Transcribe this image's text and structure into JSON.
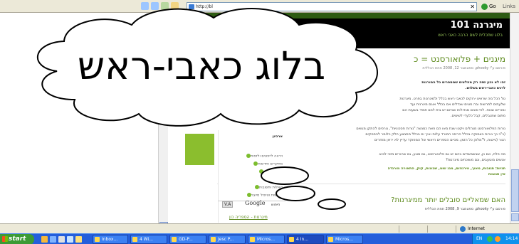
{
  "browser": {
    "address_url": "http://bl",
    "go_label": "Go",
    "links_label": "Links"
  },
  "site": {
    "title": "מיגרנה 101",
    "subtitle": "בלוג שתכלית לשם הרבה כאבי ראש"
  },
  "post1": {
    "title": "מיגנים + פלואורסנט = כ",
    "meta": "פורסם ע\"י phooky, ספטמבר 12, 2008 תחת הכללית",
    "lead": "זהו לא נכון שזה רק מהלצים שמספרים כל המורנות",
    "lead2": "לרגש כאבי-ראש בשלוש.",
    "p1": "טל הכל מה שראינו ירוקים לכאבי ראש בכלל ולמיגרנות בפרט. מיגרנות",
    "p2": "שלעתים לתרשות ובה סוגים שגדלים אם בכלל אוגם מיגרנית ועד",
    "p3": "ומוריים וצוות. לפי סוגים מגדולות שגדום יש בית לנים תמיד בשעות הם",
    "p4": "מתום שמגבלים, קבל כלעדי לשינוים.",
    "p5": "נורות הפלואורסנט מנהלים ויקטו שנת מאו הם וזאת כמנשה \"נורות חסכוניות\", נורסים להתקן מגשים",
    "p6": "(כ\"כ כך נורות בצמוקה בכלל הריפוי המורד עלות ואיך ים בכלל מתבצע חלק כלומר להפסקים",
    "p7": "הנור (נייטות, ל\"מלוק כל הזמן. מכיים הספרים היאשי של המפוקד עדיין לא ירויון מחזרים",
    "p8": "מה פלח, אם כן, שבשמשדים בהם יש גם פלואורסנט, גם מוגע, גם שהורים מזכי לבוא",
    "p9": "אנשים מוטעבים, וגם משוכחים מיגרנות?",
    "tags_label": "תגיות: תגובות, מאוך, ווירנוזום, מגנ שוט, שבונות, קוק, התאורה מורגדה",
    "tags_more": "אין תגובות",
    "title2": "האם שמאליים סובלים יותר ממיגרנות?",
    "meta2": "פורסם ע\"י phooky, ספטמבר 9, 2008 תחת הכללית"
  },
  "sidebar": {
    "heading": "ארכיון",
    "items": [
      "ויראה לייפוגים ולזפות",
      "מחקרים וחדשות",
      "מיגרני פקרה",
      "מיגרניום",
      "שאלות ותשובות",
      "הרגשות וטיפול מיוצר"
    ],
    "google_label": "Google",
    "search_label": "חיפוש",
    "search_button": "V.A",
    "bottom_link": "מיגרנות - הספריה כון"
  },
  "callout": {
    "text": "בלוג כאבי-ראש"
  },
  "status": {
    "zone": "Internet"
  },
  "taskbar": {
    "start_label": "start",
    "tasks": [
      "Inbox...",
      "4 Wi...",
      "GD-P...",
      "Jesc P...",
      "Micros...",
      "4 In...",
      "Micros..."
    ],
    "lang": "EN",
    "clock": "14:14"
  },
  "colors": {
    "accent_green": "#5d8a1c",
    "header_bg": "#000000",
    "taskbar_blue": "#245edb"
  }
}
